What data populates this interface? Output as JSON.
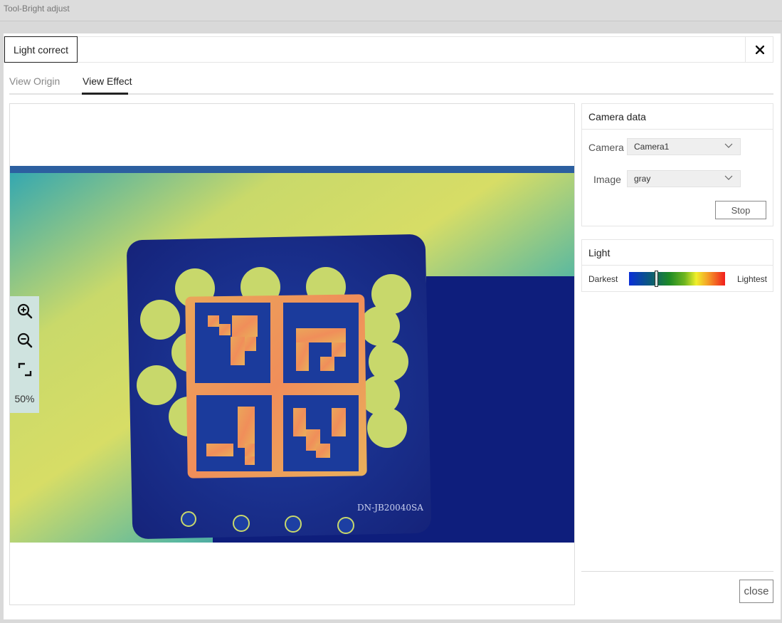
{
  "window": {
    "title": "Tool-Bright adjust"
  },
  "header": {
    "tab_label": "Light correct",
    "close_glyph": "✕"
  },
  "view_tabs": [
    {
      "label": "View Origin",
      "active": false
    },
    {
      "label": "View Effect",
      "active": true
    }
  ],
  "canvas": {
    "zoom_level": "50%",
    "plate_text": "DN-JB20040SA",
    "icons": [
      "zoom-in-icon",
      "zoom-out-icon",
      "fit-screen-icon"
    ]
  },
  "camera_data": {
    "title": "Camera data",
    "camera_label": "Camera",
    "camera_value": "Camera1",
    "image_label": "Image",
    "image_value": "gray",
    "stop_label": "Stop"
  },
  "light": {
    "title": "Light",
    "darkest_label": "Darkest",
    "lightest_label": "Lightest",
    "level": 0.28,
    "colors": [
      "#0a2fd8",
      "#1d8a25",
      "#f0ef2a",
      "#f11d1d"
    ]
  },
  "footer": {
    "close_label": "close"
  }
}
